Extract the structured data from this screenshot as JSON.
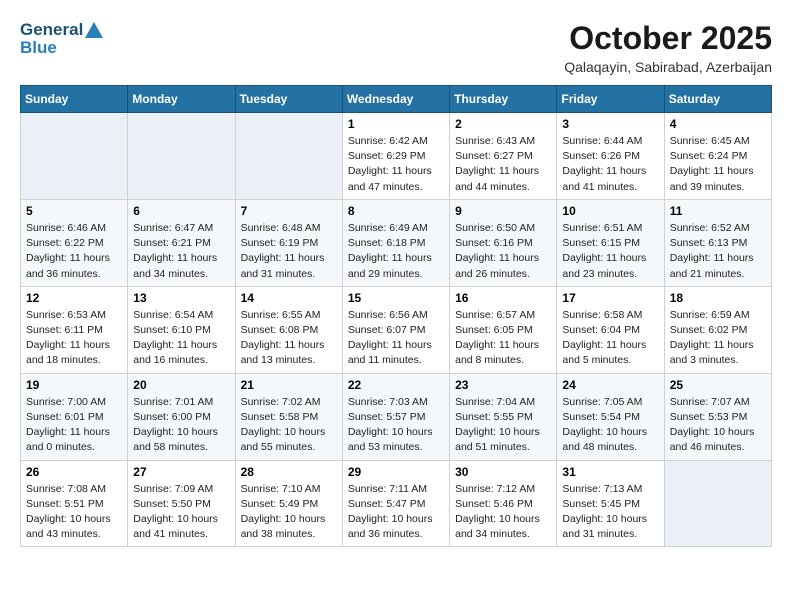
{
  "header": {
    "logo_general": "General",
    "logo_blue": "Blue",
    "month_title": "October 2025",
    "location": "Qalaqayin, Sabirabad, Azerbaijan"
  },
  "days_of_week": [
    "Sunday",
    "Monday",
    "Tuesday",
    "Wednesday",
    "Thursday",
    "Friday",
    "Saturday"
  ],
  "weeks": [
    [
      {
        "day": "",
        "info": ""
      },
      {
        "day": "",
        "info": ""
      },
      {
        "day": "",
        "info": ""
      },
      {
        "day": "1",
        "info": "Sunrise: 6:42 AM\nSunset: 6:29 PM\nDaylight: 11 hours\nand 47 minutes."
      },
      {
        "day": "2",
        "info": "Sunrise: 6:43 AM\nSunset: 6:27 PM\nDaylight: 11 hours\nand 44 minutes."
      },
      {
        "day": "3",
        "info": "Sunrise: 6:44 AM\nSunset: 6:26 PM\nDaylight: 11 hours\nand 41 minutes."
      },
      {
        "day": "4",
        "info": "Sunrise: 6:45 AM\nSunset: 6:24 PM\nDaylight: 11 hours\nand 39 minutes."
      }
    ],
    [
      {
        "day": "5",
        "info": "Sunrise: 6:46 AM\nSunset: 6:22 PM\nDaylight: 11 hours\nand 36 minutes."
      },
      {
        "day": "6",
        "info": "Sunrise: 6:47 AM\nSunset: 6:21 PM\nDaylight: 11 hours\nand 34 minutes."
      },
      {
        "day": "7",
        "info": "Sunrise: 6:48 AM\nSunset: 6:19 PM\nDaylight: 11 hours\nand 31 minutes."
      },
      {
        "day": "8",
        "info": "Sunrise: 6:49 AM\nSunset: 6:18 PM\nDaylight: 11 hours\nand 29 minutes."
      },
      {
        "day": "9",
        "info": "Sunrise: 6:50 AM\nSunset: 6:16 PM\nDaylight: 11 hours\nand 26 minutes."
      },
      {
        "day": "10",
        "info": "Sunrise: 6:51 AM\nSunset: 6:15 PM\nDaylight: 11 hours\nand 23 minutes."
      },
      {
        "day": "11",
        "info": "Sunrise: 6:52 AM\nSunset: 6:13 PM\nDaylight: 11 hours\nand 21 minutes."
      }
    ],
    [
      {
        "day": "12",
        "info": "Sunrise: 6:53 AM\nSunset: 6:11 PM\nDaylight: 11 hours\nand 18 minutes."
      },
      {
        "day": "13",
        "info": "Sunrise: 6:54 AM\nSunset: 6:10 PM\nDaylight: 11 hours\nand 16 minutes."
      },
      {
        "day": "14",
        "info": "Sunrise: 6:55 AM\nSunset: 6:08 PM\nDaylight: 11 hours\nand 13 minutes."
      },
      {
        "day": "15",
        "info": "Sunrise: 6:56 AM\nSunset: 6:07 PM\nDaylight: 11 hours\nand 11 minutes."
      },
      {
        "day": "16",
        "info": "Sunrise: 6:57 AM\nSunset: 6:05 PM\nDaylight: 11 hours\nand 8 minutes."
      },
      {
        "day": "17",
        "info": "Sunrise: 6:58 AM\nSunset: 6:04 PM\nDaylight: 11 hours\nand 5 minutes."
      },
      {
        "day": "18",
        "info": "Sunrise: 6:59 AM\nSunset: 6:02 PM\nDaylight: 11 hours\nand 3 minutes."
      }
    ],
    [
      {
        "day": "19",
        "info": "Sunrise: 7:00 AM\nSunset: 6:01 PM\nDaylight: 11 hours\nand 0 minutes."
      },
      {
        "day": "20",
        "info": "Sunrise: 7:01 AM\nSunset: 6:00 PM\nDaylight: 10 hours\nand 58 minutes."
      },
      {
        "day": "21",
        "info": "Sunrise: 7:02 AM\nSunset: 5:58 PM\nDaylight: 10 hours\nand 55 minutes."
      },
      {
        "day": "22",
        "info": "Sunrise: 7:03 AM\nSunset: 5:57 PM\nDaylight: 10 hours\nand 53 minutes."
      },
      {
        "day": "23",
        "info": "Sunrise: 7:04 AM\nSunset: 5:55 PM\nDaylight: 10 hours\nand 51 minutes."
      },
      {
        "day": "24",
        "info": "Sunrise: 7:05 AM\nSunset: 5:54 PM\nDaylight: 10 hours\nand 48 minutes."
      },
      {
        "day": "25",
        "info": "Sunrise: 7:07 AM\nSunset: 5:53 PM\nDaylight: 10 hours\nand 46 minutes."
      }
    ],
    [
      {
        "day": "26",
        "info": "Sunrise: 7:08 AM\nSunset: 5:51 PM\nDaylight: 10 hours\nand 43 minutes."
      },
      {
        "day": "27",
        "info": "Sunrise: 7:09 AM\nSunset: 5:50 PM\nDaylight: 10 hours\nand 41 minutes."
      },
      {
        "day": "28",
        "info": "Sunrise: 7:10 AM\nSunset: 5:49 PM\nDaylight: 10 hours\nand 38 minutes."
      },
      {
        "day": "29",
        "info": "Sunrise: 7:11 AM\nSunset: 5:47 PM\nDaylight: 10 hours\nand 36 minutes."
      },
      {
        "day": "30",
        "info": "Sunrise: 7:12 AM\nSunset: 5:46 PM\nDaylight: 10 hours\nand 34 minutes."
      },
      {
        "day": "31",
        "info": "Sunrise: 7:13 AM\nSunset: 5:45 PM\nDaylight: 10 hours\nand 31 minutes."
      },
      {
        "day": "",
        "info": ""
      }
    ]
  ]
}
